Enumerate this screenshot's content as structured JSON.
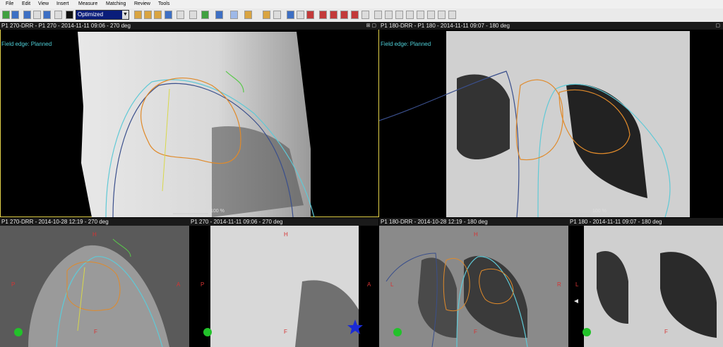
{
  "menubar": {
    "items": [
      "File",
      "Edit",
      "View",
      "Insert",
      "Measure",
      "Matching",
      "Review",
      "Tools"
    ]
  },
  "toolbar": {
    "select_value": "Optimized"
  },
  "panels": {
    "top_left": {
      "title": "P1 270-DRR - P1 270 - 2014-11-11 09:06 - 270 deg",
      "field_edge": "Field edge: Planned",
      "scale": "100 %"
    },
    "top_right": {
      "title": "P1 180-DRR - P1 180 - 2014-11-11 09:07 - 180 deg",
      "field_edge": "Field edge: Planned",
      "scale": "100 %"
    },
    "bottom_1": {
      "title": "P1 270-DRR - 2014-10-28 12:19 - 270 deg",
      "H": "H",
      "P": "P",
      "A": "A",
      "F": "F"
    },
    "bottom_2": {
      "title": "P1 270 - 2014-11-11 09:06 - 270 deg",
      "H": "H",
      "P": "P",
      "A": "A",
      "F": "F"
    },
    "bottom_3": {
      "title": "P1 180-DRR - 2014-10-28 12:19 - 180 deg",
      "H": "H",
      "L": "L",
      "R": "R",
      "F": "F"
    },
    "bottom_4": {
      "title": "P1 180 - 2014-11-11 09:07 - 180 deg",
      "L": "L",
      "F": "F"
    }
  },
  "colors": {
    "field_edge": "#4fd0d8",
    "ptv": "#e08a2a",
    "lung": "#4060b0",
    "orientation": "#d63333",
    "active_border": "#e4d24a"
  }
}
